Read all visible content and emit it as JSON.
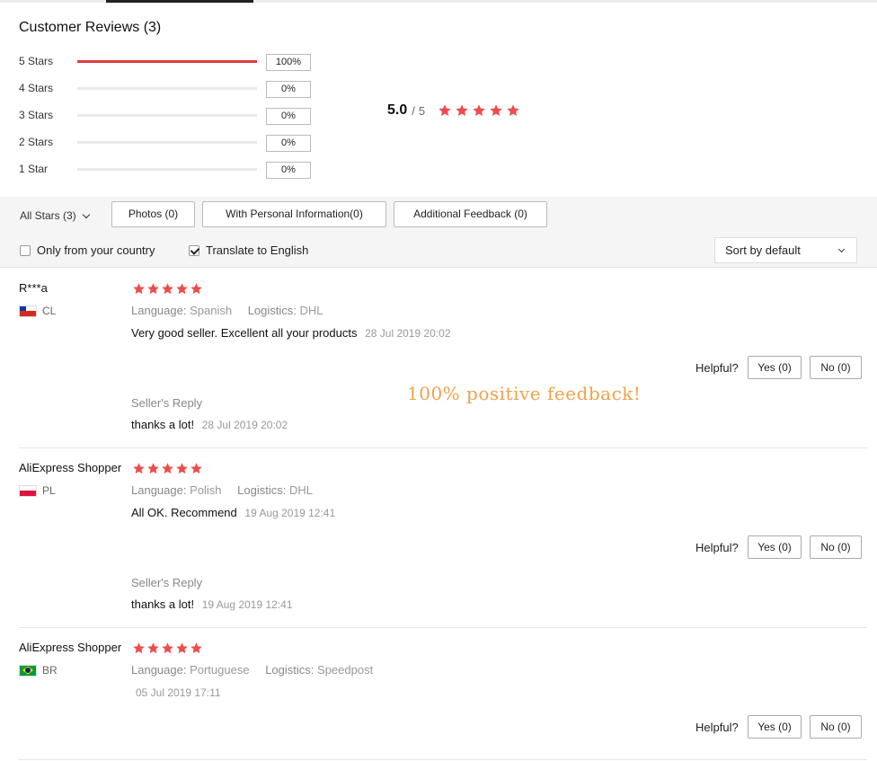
{
  "section": {
    "title": "Customer Reviews (3)"
  },
  "histogram": [
    {
      "label": "5 Stars",
      "percent": "100%",
      "fill": 1.0
    },
    {
      "label": "4 Stars",
      "percent": "0%",
      "fill": 0.0
    },
    {
      "label": "3 Stars",
      "percent": "0%",
      "fill": 0.0
    },
    {
      "label": "2 Stars",
      "percent": "0%",
      "fill": 0.0
    },
    {
      "label": "1 Star",
      "percent": "0%",
      "fill": 0.0
    }
  ],
  "average": {
    "score": "5.0",
    "separator": "/",
    "max": "5",
    "stars": 5
  },
  "filters": {
    "all_stars": "All Stars (3)",
    "photos": "Photos (0)",
    "personal": "With Personal Information(0)",
    "additional": "Additional Feedback (0)",
    "only_country": "Only from your country",
    "only_country_checked": false,
    "translate": "Translate to English",
    "translate_checked": true,
    "sort": "Sort by default"
  },
  "labels": {
    "language": "Language:",
    "logistics": "Logistics:",
    "helpful": "Helpful?",
    "sellers_reply": "Seller's Reply"
  },
  "reviews": [
    {
      "name": "R***a",
      "country": "CL",
      "flag": "chile",
      "stars": 5,
      "language": "Spanish",
      "logistics": "DHL",
      "text": "Very good seller. Excellent all your products",
      "date": "28 Jul 2019 20:02",
      "yes": "Yes (0)",
      "no": "No (0)",
      "reply": "thanks a lot!",
      "reply_date": "28 Jul 2019 20:02"
    },
    {
      "name": "AliExpress Shopper",
      "country": "PL",
      "flag": "poland",
      "stars": 5,
      "language": "Polish",
      "logistics": "DHL",
      "text": "All OK. Recommend",
      "date": "19 Aug 2019 12:41",
      "yes": "Yes (0)",
      "no": "No (0)",
      "reply": "thanks a lot!",
      "reply_date": "19 Aug 2019 12:41"
    },
    {
      "name": "AliExpress Shopper",
      "country": "BR",
      "flag": "brazil",
      "stars": 5,
      "language": "Portuguese",
      "logistics": "Speedpost",
      "text": "",
      "date": "05 Jul 2019 17:11",
      "yes": "Yes (0)",
      "no": "No (0)"
    }
  ],
  "promo_overlay": "100% positive feedback!",
  "colors": {
    "star": "#ef4b4b",
    "bar": "#e4393c",
    "overlay": "#f0a24c"
  }
}
